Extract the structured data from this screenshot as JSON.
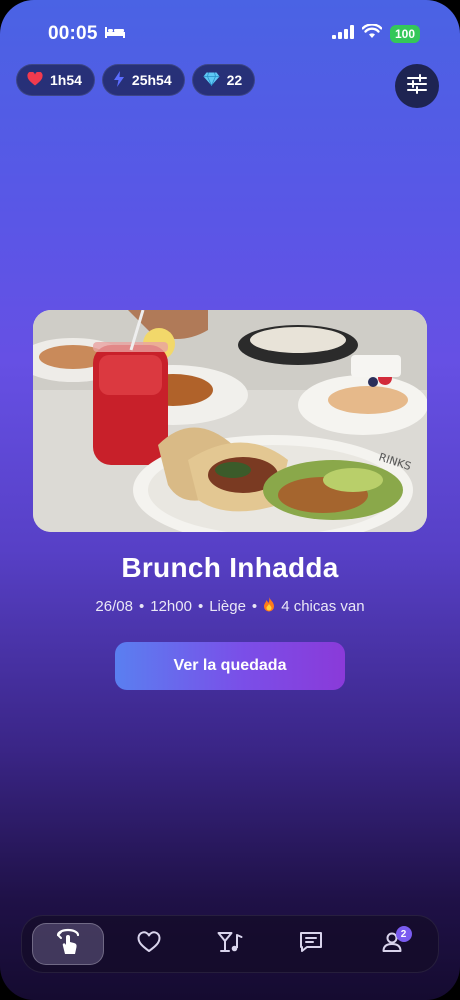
{
  "status_bar": {
    "time": "00:05",
    "battery": "100"
  },
  "pills": [
    {
      "icon": "heart-icon",
      "value": "1h54"
    },
    {
      "icon": "bolt-icon",
      "value": "25h54"
    },
    {
      "icon": "diamond-icon",
      "value": "22"
    }
  ],
  "event": {
    "title": "Brunch Inhadda",
    "date": "26/08",
    "time": "12h00",
    "city": "Liège",
    "attendees": "4 chicas van",
    "cta_label": "Ver la quedada"
  },
  "nav": {
    "items": [
      "swipe-tap-icon",
      "heart-icon",
      "drinks-music-icon",
      "chat-icon",
      "profile-icon"
    ],
    "profile_badge": "2"
  },
  "colors": {
    "accent": "#7a5cf0",
    "battery": "#34c759"
  }
}
